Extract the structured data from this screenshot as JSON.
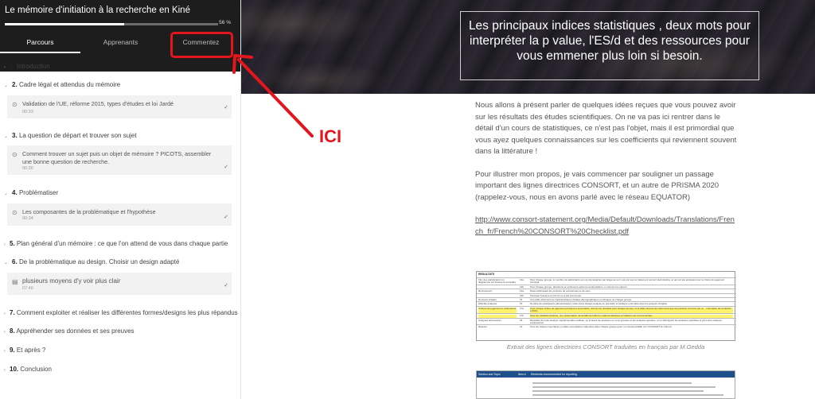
{
  "course": {
    "title": "Le mémoire d'initiation à la recherche en Kiné",
    "progress_label": "56 %",
    "progress_fraction": 0.56
  },
  "tabs": [
    {
      "label": "Parcours",
      "active": true
    },
    {
      "label": "Apprenants",
      "active": false
    },
    {
      "label": "Commentez",
      "active": false
    }
  ],
  "chapters": [
    {
      "num": "1.",
      "title": "Introduction"
    },
    {
      "num": "2.",
      "title": "Cadre légal et attendus du mémoire"
    },
    {
      "num": "3.",
      "title": "La question de départ et trouver son sujet"
    },
    {
      "num": "4.",
      "title": "Problématiser"
    },
    {
      "num": "5.",
      "title": "Plan général d'un mémoire : ce que l'on attend de vous dans chaque partie"
    },
    {
      "num": "6.",
      "title": "De la problématique au design. Choisir un design adapté"
    },
    {
      "num": "7.",
      "title": "Comment exploiter et réaliser les différentes formes/designs les plus répandus"
    },
    {
      "num": "8.",
      "title": "Appréhender ses données et ses preuves"
    },
    {
      "num": "9.",
      "title": "Et après ?"
    },
    {
      "num": "10.",
      "title": "Conclusion"
    }
  ],
  "lessons": [
    {
      "title": "Validation de l'UE, réforme 2015, types d'études et loi Jardé",
      "duration": "00:33"
    },
    {
      "title": "Comment trouver un sujet puis un objet de mémoire ? PICOTS, assembler une bonne question de recherche.",
      "duration": "00:30"
    },
    {
      "title": "Les composantes de la problématique et l'hypothèse",
      "duration": "00:34"
    },
    {
      "title": "plusieurs moyens d'y voir plus clair",
      "duration": "07:40"
    }
  ],
  "annotation": {
    "label": "ICI",
    "color": "#e3161e"
  },
  "banner": {
    "title": "Les principaux indices statistiques , deux mots pour interpréter la p value, l'ES/d et des ressources pour vous emmener plus loin si besoin."
  },
  "content": {
    "paragraphs": [
      "Nous allons à présent parler de quelques idées reçues que vous pouvez avoir sur les résultats des études scientifiques. On ne va pas ici rentrer dans le détail d'un cours de statistiques, ce n'est pas l'objet, mais il est primordial que vous ayez quelques connaissances sur les coefficients qui reviennent souvent dans la littérature !",
      "Pour illustrer mon propos, je vais commencer par souligner un passage important des lignes directrices CONSORT, et un autre de PRISMA 2020 (rappelez-vous, nous en avons parlé avec le réseau EQUATOR)"
    ],
    "link": "http://www.consort-statement.org/Media/Default/Downloads/Translations/French_fr/French%20CONSORT%20Checklist.pdf",
    "caption": "Extrait des lignes directrices CONSORT traduites en français par M.Gedda"
  },
  "table1": {
    "header": "RESULTATS",
    "rows": [
      {
        "label": "Flux des participants (un diagramme est fortement conseillé)",
        "num": "13a",
        "text": "Pour chaque groupe, le nombre de participants qui ont été assignés par tirage au sort, qui ont reçu le traitement qui leur était destiné, et qui ont été analysés pour le critère de jugement principal",
        "highlight": false
      },
      {
        "label": "",
        "num": "13b",
        "text": "Pour chaque groupe, abandons et exclusions après la randomisation, en donner les raisons",
        "highlight": false
      },
      {
        "label": "Recrutement",
        "num": "14a",
        "text": "Dates définissant les périodes de recrutement et de suivi",
        "highlight": false
      },
      {
        "label": "",
        "num": "14b",
        "text": "Pourquoi l'essai a-t-il pris fin ou a été interrompu",
        "highlight": false
      },
      {
        "label": "Données initiales",
        "num": "15",
        "text": "Une table décrivant les caractéristiques initiales démographiques et cliniques de chaque groupe",
        "highlight": false
      },
      {
        "label": "Effectifs analysés",
        "num": "16",
        "text": "Nombre de participants (dénominateur) inclus dans chaque analyse en précisant si l'analyse a été faite avec les groupes d'origine",
        "highlight": false
      },
      {
        "label": "Critères de jugement et estimations",
        "num": "17a",
        "text": "Pour chaque critère de jugement principal et secondaire, donner les résultats pour chaque groupe, et la taille estimée de l'effet ainsi que sa précision (comme par ex. : intervalles de confiance à 95%)",
        "highlight": true
      },
      {
        "label": "",
        "num": "17b",
        "text": "Pour les variables binaires, une présentation de la taille de l'effet en valeurs absolues et relatives est recommandée",
        "highlight": true
      },
      {
        "label": "Analyses accessoires",
        "num": "18",
        "text": "Résultats de toute analyse supplémentaire réalisée, en incluant les analyses en sous-groupes et les analyses ajustées, et en distinguant les analyses spécifiées à priori des analyses exploratoires",
        "highlight": false
      },
      {
        "label": "Risques",
        "num": "19",
        "text": "Tous les risques importants ou effets secondaires inattendus dans chaque groupe (pour un conseil détaillé voir 'CONSORT for harms')",
        "highlight": false
      }
    ]
  },
  "table2": {
    "headers": [
      "Section and Topic",
      "Item #",
      "Elements recommended for reporting"
    ]
  }
}
